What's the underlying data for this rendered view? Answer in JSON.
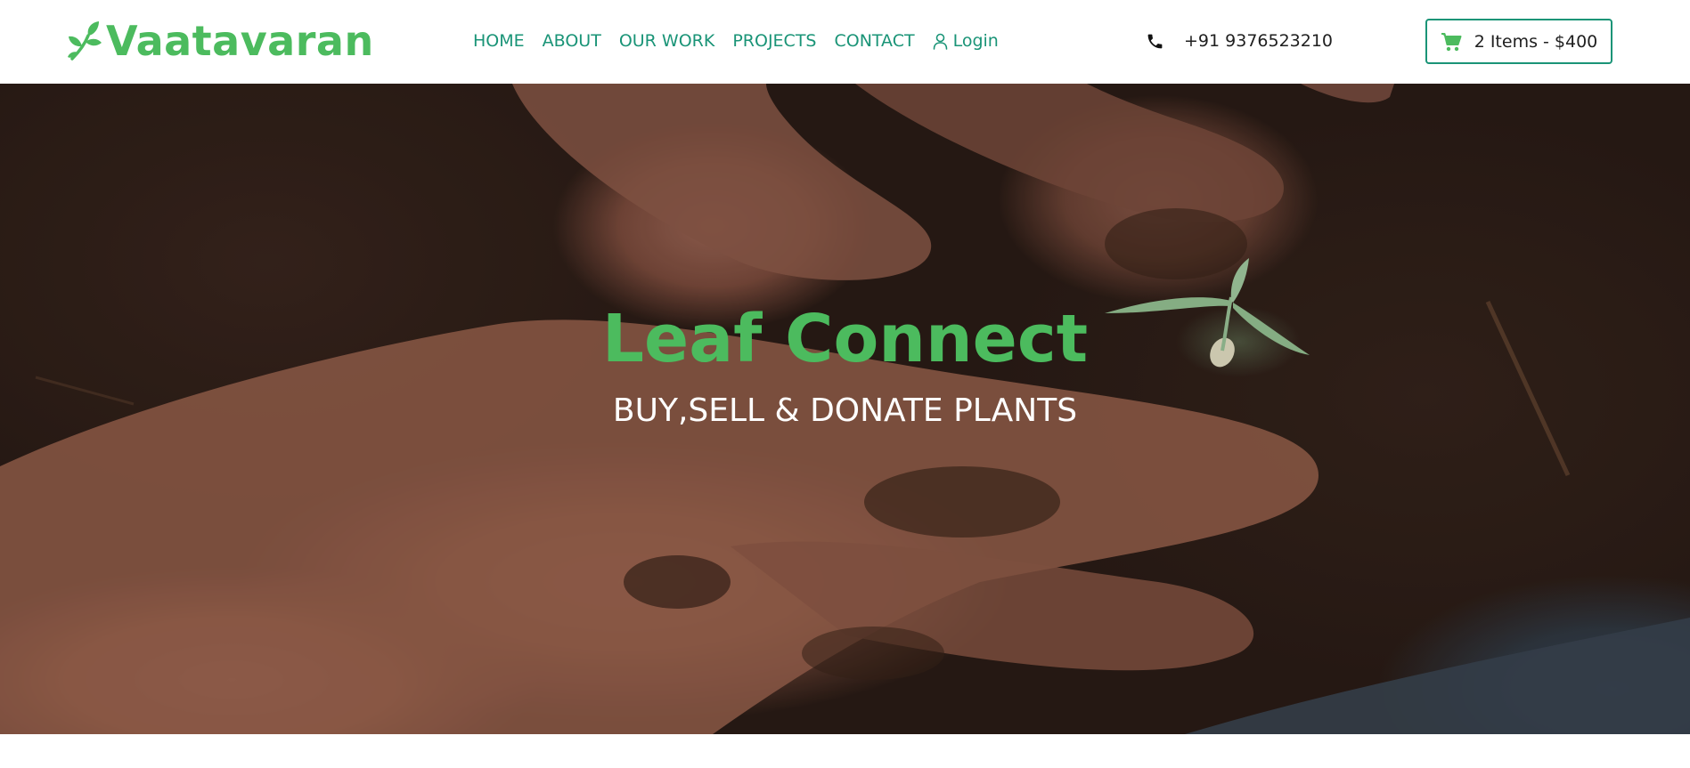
{
  "brand": {
    "name": "Vaatavaran",
    "icon": "leaf-plant-icon",
    "color": "#4cbb5e"
  },
  "nav": {
    "items": [
      "HOME",
      "ABOUT",
      "OUR WORK",
      "PROJECTS",
      "CONTACT"
    ],
    "login_label": "Login",
    "login_icon": "user-icon",
    "color": "#1a9477"
  },
  "contact": {
    "phone_icon": "phone-icon",
    "phone": "+91 9376523210"
  },
  "cart": {
    "icon": "shopping-cart-icon",
    "label": "2 Items - $400",
    "border_color": "#1a9477",
    "icon_color": "#4cbb5e"
  },
  "hero": {
    "image": "hands-planting-seedling-in-soil",
    "title": "Leaf Connect",
    "subtitle": "BUY,SELL & DONATE PLANTS",
    "title_color": "#4cbb5e",
    "subtitle_color": "#ffffff"
  }
}
